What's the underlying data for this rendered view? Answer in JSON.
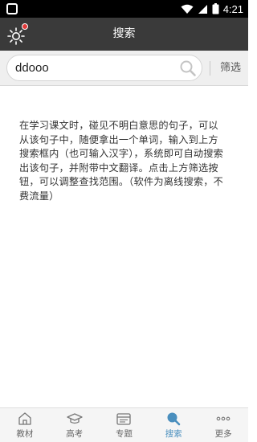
{
  "status_bar": {
    "time": "4:21"
  },
  "title_bar": {
    "title": "搜索"
  },
  "search": {
    "value": "ddooo",
    "filter_label": "筛选"
  },
  "description": "在学习课文时，碰见不明白意思的句子，可以从该句子中，随便拿出一个单词，输入到上方搜索框内（也可输入汉字），系统即可自动搜索出该句子，并附带中文翻译。点击上方筛选按钮，可以调整查找范围。（软件为离线搜索，不费流量）",
  "bottom_nav": {
    "items": [
      {
        "label": "教材",
        "icon": "home-icon"
      },
      {
        "label": "高考",
        "icon": "graduation-cap-icon"
      },
      {
        "label": "专题",
        "icon": "topic-icon"
      },
      {
        "label": "搜索",
        "icon": "search-icon"
      },
      {
        "label": "更多",
        "icon": "more-icon"
      }
    ],
    "active_index": 3
  },
  "colors": {
    "title_bar_bg": "#3a3a3a",
    "accent": "#4a8fbe",
    "notification_dot": "#e03a3a"
  }
}
